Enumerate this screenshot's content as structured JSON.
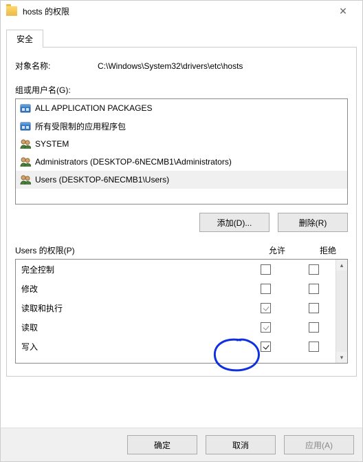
{
  "window": {
    "title": "hosts 的权限"
  },
  "tab": {
    "security": "安全"
  },
  "object": {
    "label": "对象名称:",
    "path": "C:\\Windows\\System32\\drivers\\etc\\hosts"
  },
  "groups": {
    "label": "组或用户名(G):",
    "items": [
      {
        "icon": "package-icon",
        "name": "ALL APPLICATION PACKAGES"
      },
      {
        "icon": "package-icon",
        "name": "所有受限制的应用程序包"
      },
      {
        "icon": "users-icon",
        "name": "SYSTEM"
      },
      {
        "icon": "users-icon",
        "name": "Administrators (DESKTOP-6NECMB1\\Administrators)"
      },
      {
        "icon": "users-icon",
        "name": "Users (DESKTOP-6NECMB1\\Users)"
      }
    ],
    "selected_index": 4
  },
  "buttons": {
    "add": "添加(D)...",
    "remove": "删除(R)",
    "ok": "确定",
    "cancel": "取消",
    "apply": "应用(A)"
  },
  "permissions": {
    "header_label": "Users 的权限(P)",
    "col_allow": "允许",
    "col_deny": "拒绝",
    "rows": [
      {
        "name": "完全控制",
        "allow": false,
        "allow_grey": false,
        "deny": false
      },
      {
        "name": "修改",
        "allow": false,
        "allow_grey": false,
        "deny": false
      },
      {
        "name": "读取和执行",
        "allow": true,
        "allow_grey": true,
        "deny": false
      },
      {
        "name": "读取",
        "allow": true,
        "allow_grey": true,
        "deny": false
      },
      {
        "name": "写入",
        "allow": true,
        "allow_grey": false,
        "deny": false
      }
    ]
  }
}
